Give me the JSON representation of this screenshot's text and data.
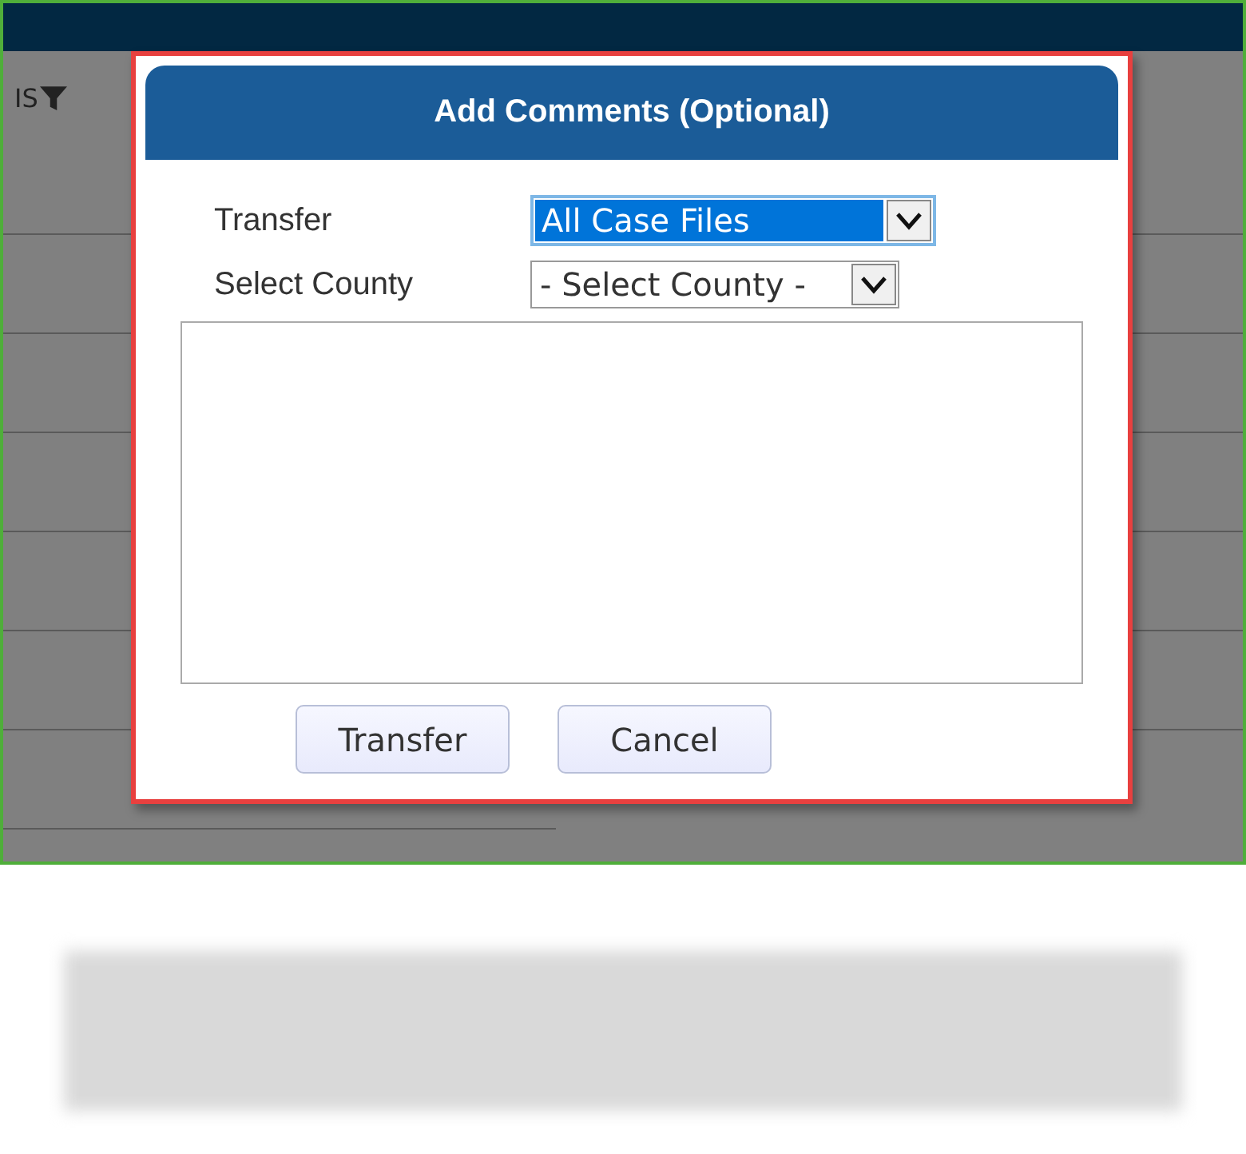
{
  "background": {
    "column_header": "IS"
  },
  "dialog": {
    "title": "Add Comments (Optional)",
    "fields": [
      {
        "label": "Transfer",
        "value": "All Case Files",
        "focused": true
      },
      {
        "label": "Select County",
        "value": "- Select County -",
        "focused": false
      }
    ],
    "buttons": [
      "Transfer",
      "Cancel"
    ]
  }
}
